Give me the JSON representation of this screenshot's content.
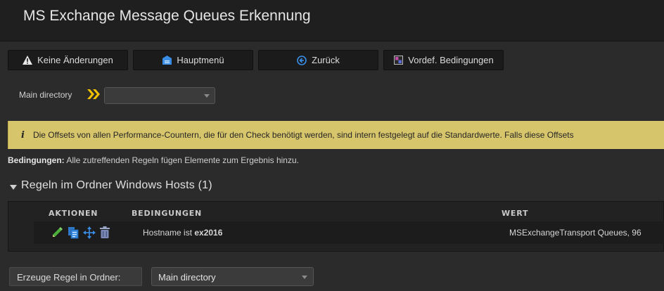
{
  "title": "MS Exchange Message Queues Erkennung",
  "toolbar": {
    "no_changes": "Keine Änderungen",
    "main_menu": "Hauptmenü",
    "back": "Zurück",
    "predefined_conditions": "Vordef. Bedingungen"
  },
  "directory": {
    "label": "Main directory",
    "value": ""
  },
  "info_text": "Die Offsets von allen Performance-Countern, die für den Check benötigt werden, sind intern festgelegt auf die Standardwerte. Falls diese Offsets",
  "conditions_line": {
    "bold": "Bedingungen:",
    "text": " Alle zutreffenden Regeln fügen Elemente zum Ergebnis hinzu."
  },
  "folder": {
    "title": "Regeln im Ordner Windows Hosts (1)"
  },
  "table": {
    "headers": {
      "actions": "AKTIONEN",
      "conditions": "BEDINGUNGEN",
      "value": "WERT"
    },
    "rows": [
      {
        "condition_prefix": "Hostname ist ",
        "condition_value": "ex2016",
        "value": "MSExchangeTransport Queues, 96"
      }
    ]
  },
  "create_rule": {
    "label": "Erzeuge Regel in Ordner:",
    "folder": "Main directory"
  },
  "colors": {
    "info_bg": "#d7c56b",
    "arrow_yellow": "#f2c200",
    "edit_green": "#4caf3c",
    "icon_blue": "#3a8ee6"
  }
}
